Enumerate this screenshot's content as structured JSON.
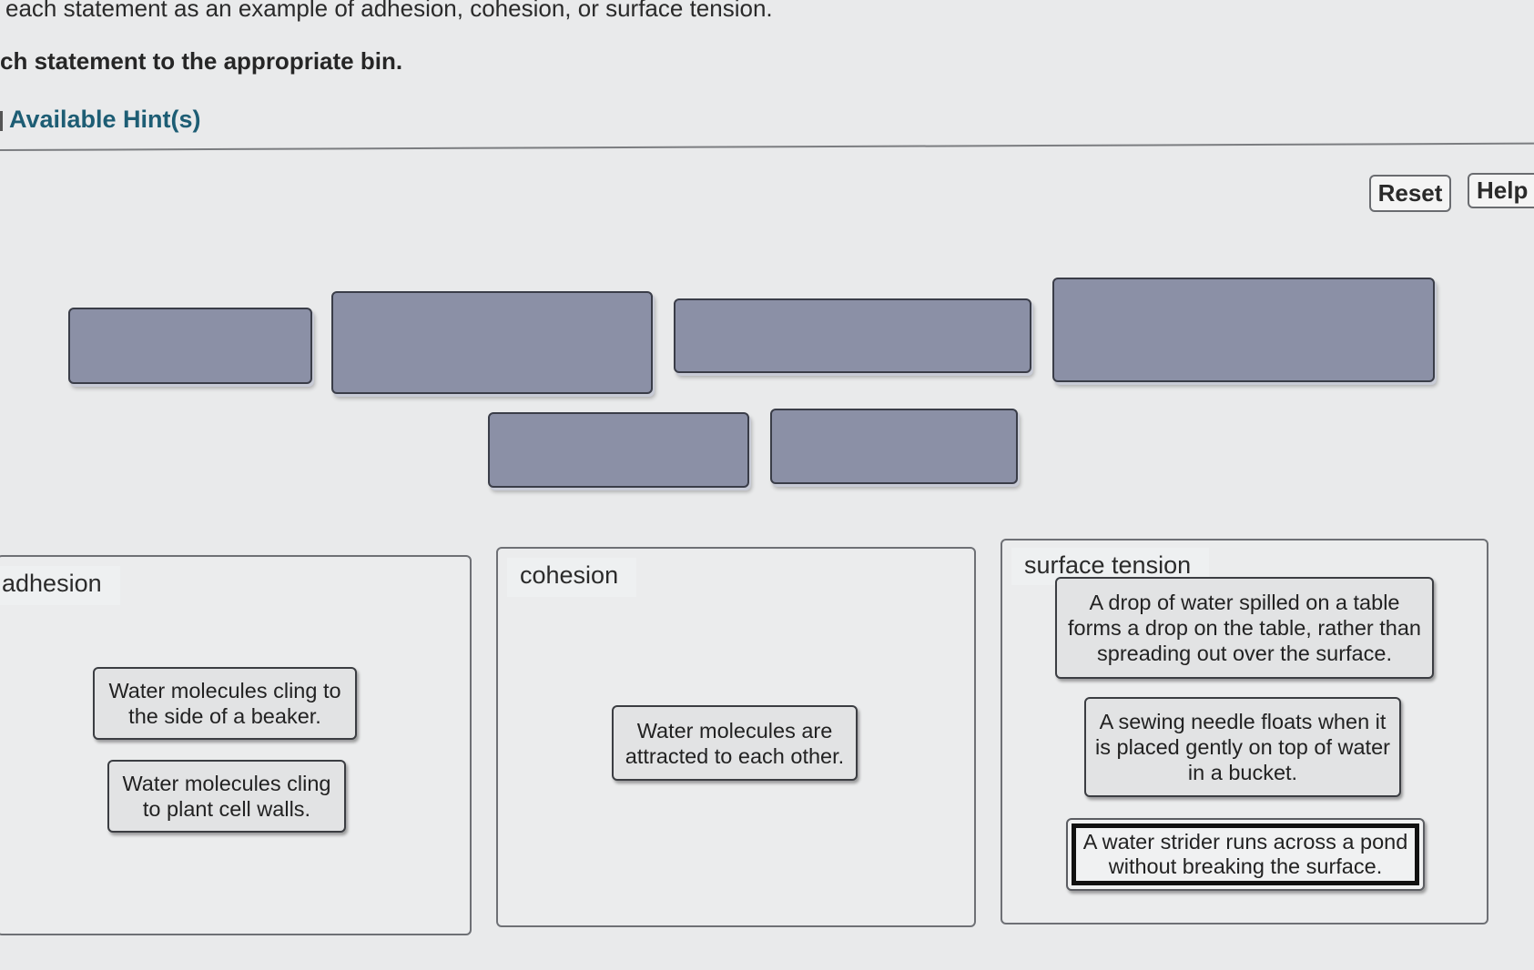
{
  "instructions": {
    "line1": "each statement as an example of adhesion, cohesion, or surface tension.",
    "line2": "ch statement to the appropriate bin.",
    "hint_link": "Available Hint(s)"
  },
  "toolbar": {
    "reset_label": "Reset",
    "help_label": "Help"
  },
  "empty_tiles_count": 6,
  "bins": [
    {
      "label": "adhesion",
      "cards": [
        "Water molecules cling to the side of a beaker.",
        "Water molecules cling to plant cell walls."
      ]
    },
    {
      "label": "cohesion",
      "cards": [
        "Water molecules are attracted to each other."
      ]
    },
    {
      "label": "surface tension",
      "cards": [
        "A drop of water spilled on a table forms a drop on the table, rather than spreading out over the surface.",
        "A sewing needle floats when it is placed gently on top of water in a bucket.",
        "A water strider runs across a pond without breaking the surface."
      ]
    }
  ],
  "selected_card": "A water strider runs across a pond without breaking the surface.",
  "colors": {
    "hint_link": "#1d5d74",
    "empty_tile": "#8b90a6",
    "background": "#e9eaeb"
  }
}
